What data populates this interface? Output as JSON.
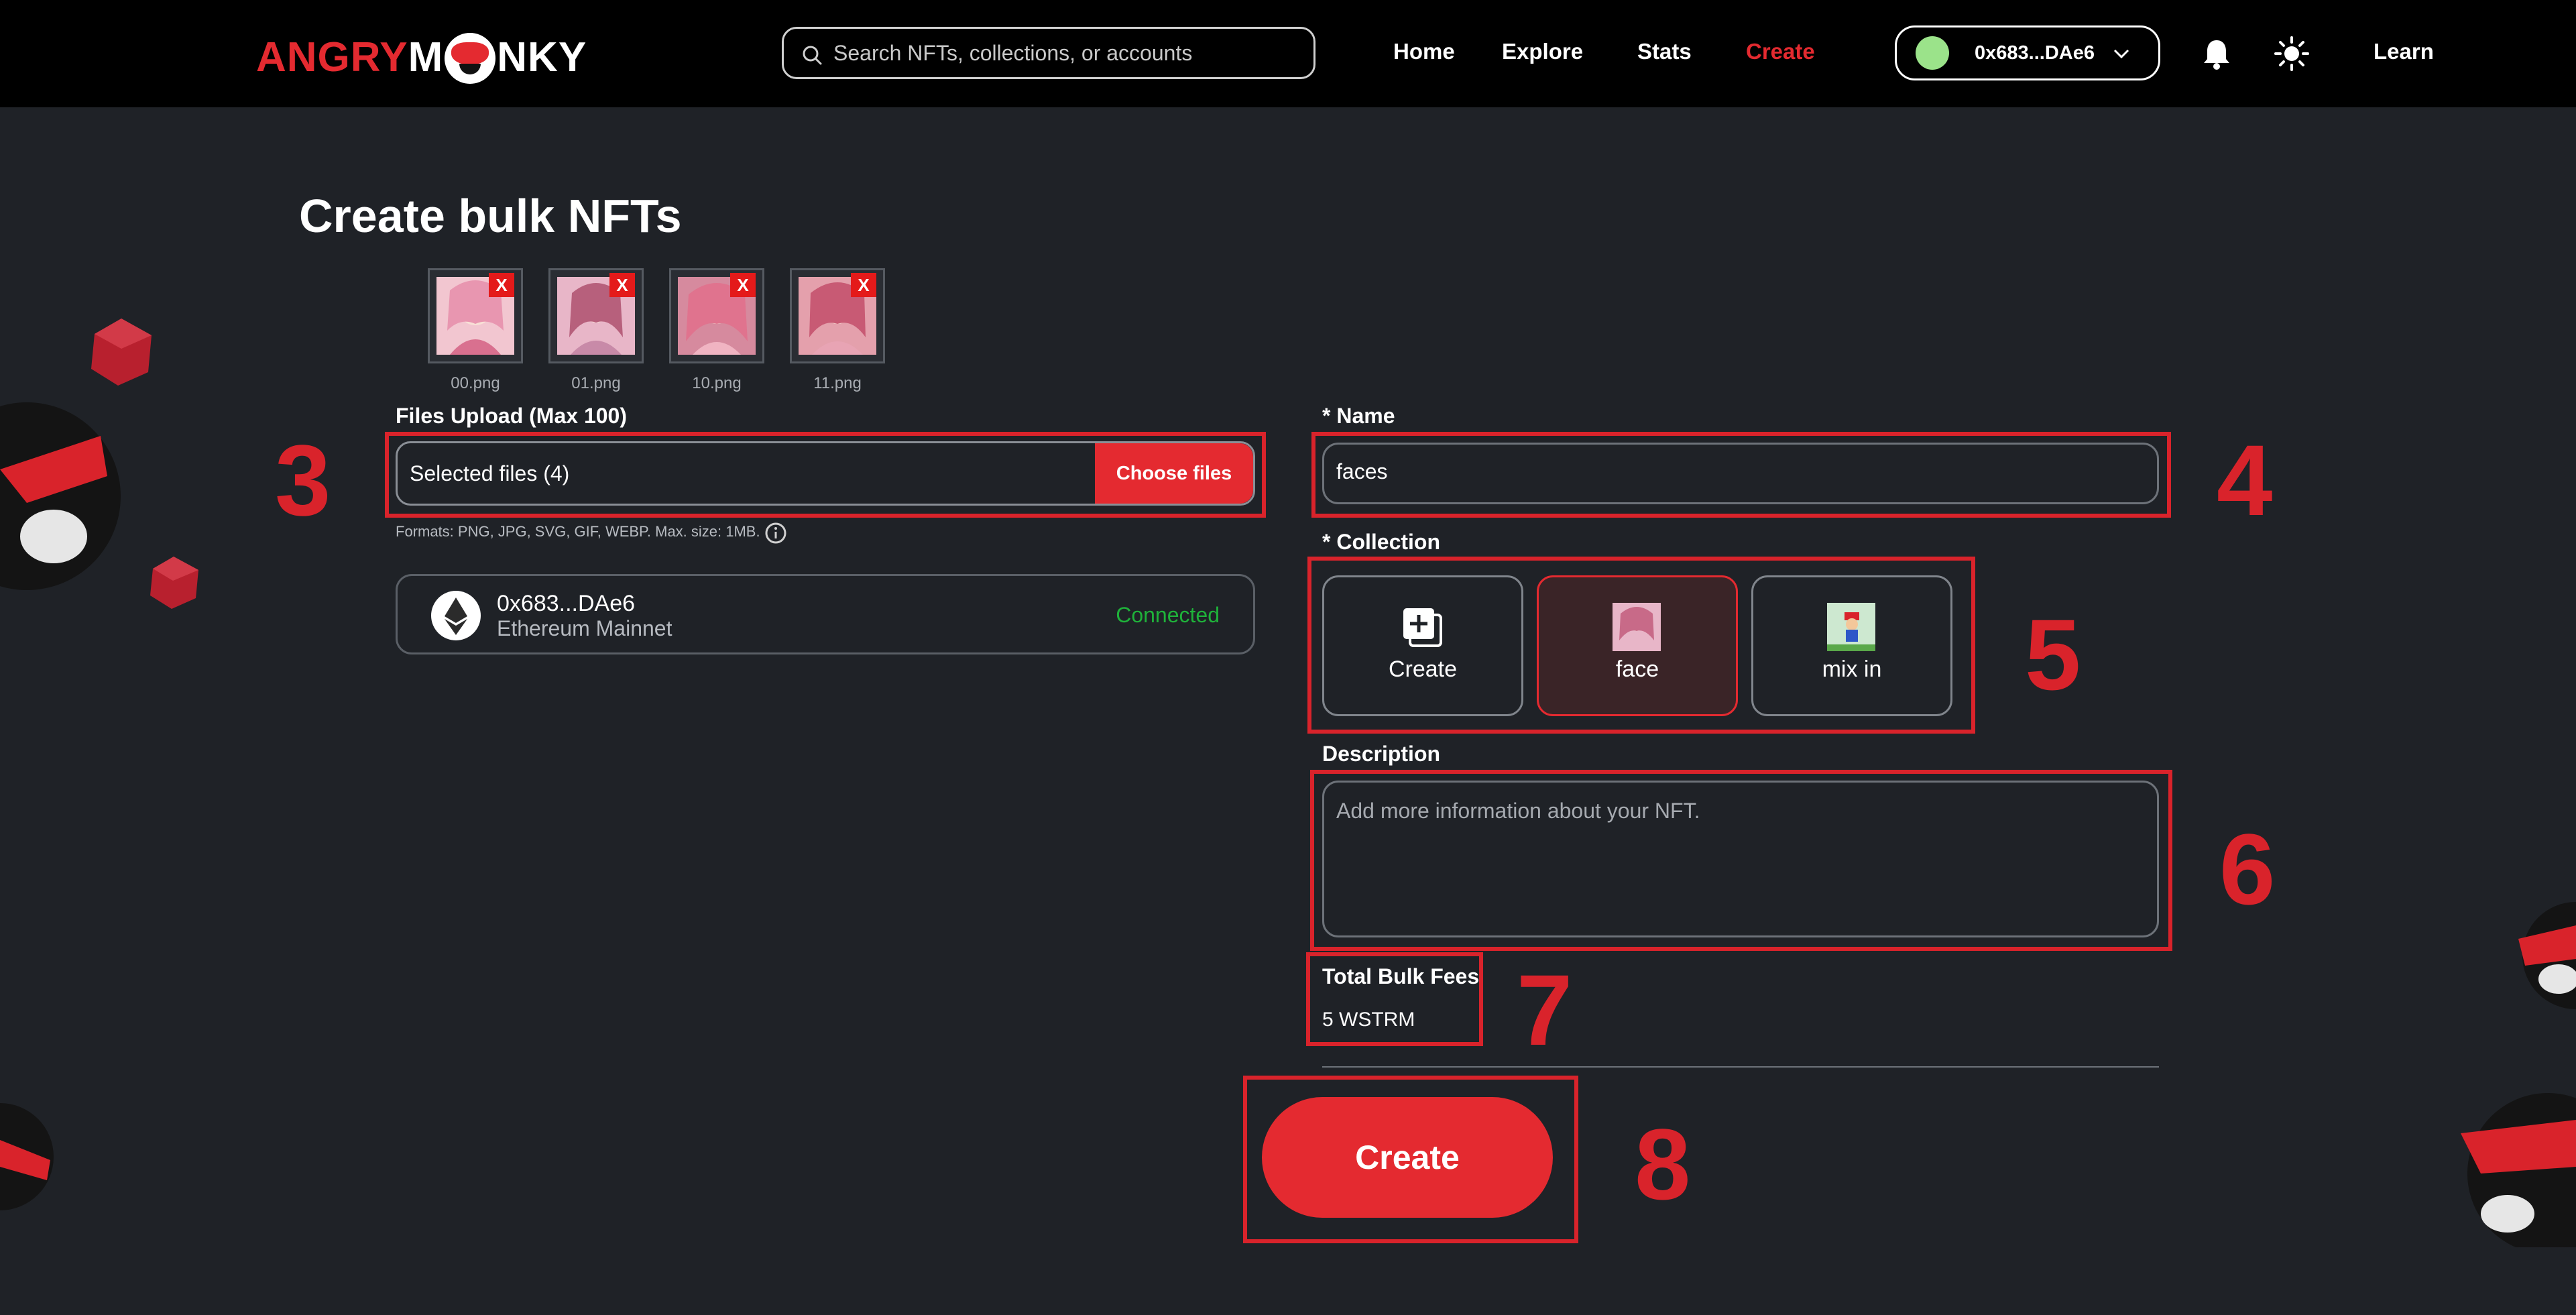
{
  "navbar": {
    "logo_left": "ANGRY",
    "logo_right": "NKY",
    "search_placeholder": "Search NFTs, collections, or accounts",
    "links": [
      "Home",
      "Explore",
      "Stats",
      "Create"
    ],
    "active_link": "Create",
    "wallet_address": "0x683...DAe6",
    "learn": "Learn"
  },
  "page": {
    "title": "Create bulk NFTs",
    "thumbnails": [
      {
        "file": "00.png",
        "remove": "X"
      },
      {
        "file": "01.png",
        "remove": "X"
      },
      {
        "file": "10.png",
        "remove": "X"
      },
      {
        "file": "11.png",
        "remove": "X"
      }
    ],
    "upload": {
      "label": "Files Upload (Max 100)",
      "value": "Selected files (4)",
      "button": "Choose files",
      "formats": "Formats: PNG, JPG, SVG, GIF, WEBP. Max. size: 1MB."
    },
    "network": {
      "address": "0x683...DAe6",
      "name": "Ethereum Mainnet",
      "status": "Connected"
    },
    "name_field": {
      "label": "* Name",
      "value": "faces"
    },
    "collection": {
      "label": "* Collection",
      "options": [
        {
          "label": "Create",
          "selected": false
        },
        {
          "label": "face",
          "selected": true
        },
        {
          "label": "mix in",
          "selected": false
        }
      ]
    },
    "description": {
      "label": "Description",
      "placeholder": "Add more information about your NFT."
    },
    "fees": {
      "label": "Total Bulk Fees",
      "value": "5 WSTRM"
    },
    "create_button": "Create"
  },
  "annotations": [
    "3",
    "4",
    "5",
    "6",
    "7",
    "8"
  ],
  "colors": {
    "accent": "#e42a30",
    "background": "#1f2227",
    "navbar": "#000000",
    "connected": "#1fb23a",
    "annotation": "#d9232b"
  }
}
